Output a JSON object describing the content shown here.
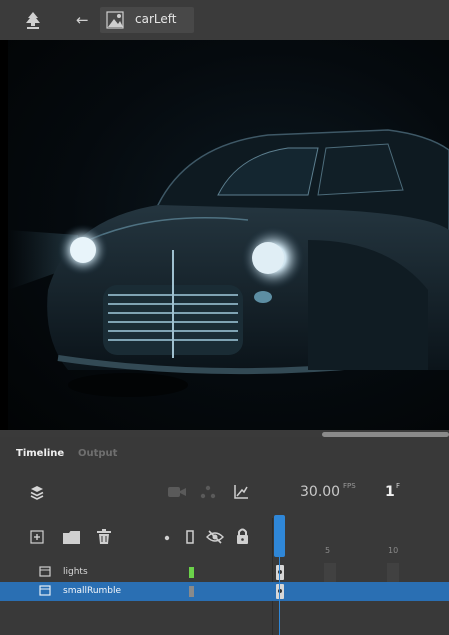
{
  "edit_bar": {
    "symbol_name": "carLeft",
    "icons": [
      "scene-icon",
      "back-arrow-icon",
      "graphic-symbol-icon"
    ]
  },
  "stage": {
    "content": "car-at-night-image"
  },
  "panel": {
    "tabs": [
      {
        "label": "Timeline",
        "active": true
      },
      {
        "label": "Output",
        "active": false
      }
    ],
    "toolbar_icons": [
      "layers-icon",
      "camera-icon",
      "layer-depth-icon",
      "easing-graph-icon"
    ],
    "fps_value": "30.00",
    "fps_unit": "FPS",
    "current_frame": "1",
    "frame_unit": "F",
    "layer_controls": [
      "add-layer-icon",
      "add-folder-icon",
      "delete-icon",
      "highlight-dot-icon",
      "outline-icon",
      "visibility-icon",
      "lock-icon"
    ],
    "ruler": [
      "5",
      "10"
    ],
    "layers": [
      {
        "name": "lights",
        "color": "#6bd24a",
        "selected": false
      },
      {
        "name": "smallRumble",
        "color": "#8a8a8a",
        "selected": true
      }
    ]
  },
  "colors": {
    "accent": "#2f87d8",
    "selected_row": "#2a6fb3"
  }
}
